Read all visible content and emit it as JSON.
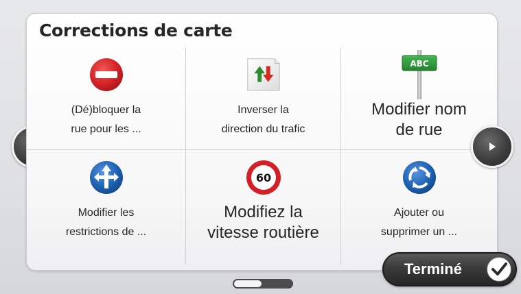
{
  "title": "Corrections de carte",
  "items": [
    {
      "label": "(Dé)bloquer la\nrue pour les ...",
      "icon": "no-entry-icon"
    },
    {
      "label": "Inverser la\ndirection du trafic",
      "icon": "reverse-traffic-icon"
    },
    {
      "label": "Modifier nom\nde rue",
      "icon": "street-sign-icon",
      "sign_text": "ABC"
    },
    {
      "label": "Modifier les\nrestrictions de ...",
      "icon": "turn-restriction-icon"
    },
    {
      "label": "Modifiez la\nvitesse routière",
      "icon": "speed-limit-icon",
      "speed_value": "60"
    },
    {
      "label": "Ajouter ou\nsupprimer un ...",
      "icon": "roundabout-icon"
    }
  ],
  "nav": {
    "previous": "left-arrow-icon",
    "next": "right-arrow-icon"
  },
  "done_button": {
    "label": "Terminé",
    "icon": "checkmark-icon"
  },
  "page_indicator": {
    "current_page": 1,
    "total_pages": 2
  },
  "colors": {
    "no_entry_red": "#d5242a",
    "sign_green": "#2f9a3e",
    "sign_blue": "#1f63b5",
    "speed_red": "#d31f26",
    "arrow_green": "#2d8a2d",
    "arrow_red": "#d42a24"
  }
}
